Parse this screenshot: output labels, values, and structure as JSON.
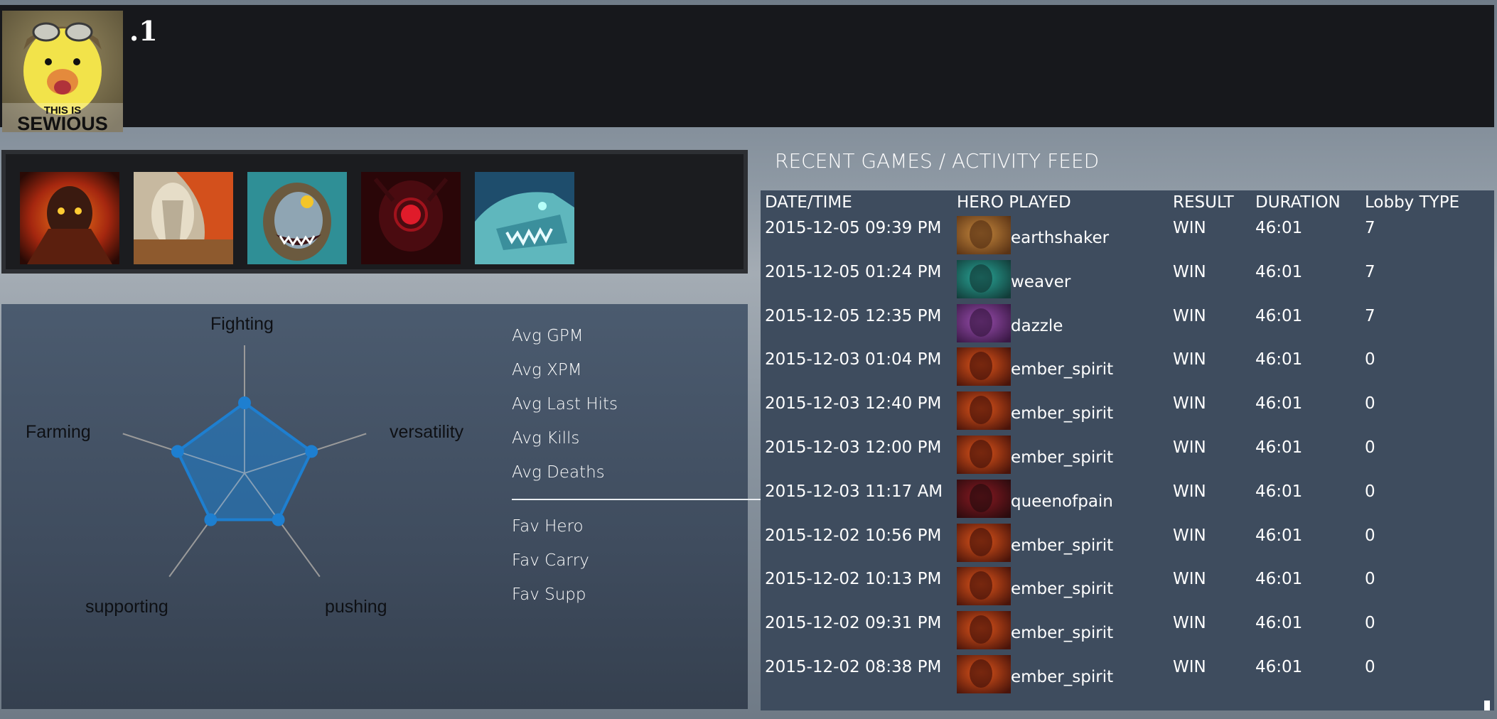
{
  "header": {
    "username": ".1",
    "avatar_caption_top": "THIS IS",
    "avatar_caption_bottom": "SEWIOUS"
  },
  "hero_strip": {
    "heroes": [
      "ember_spirit",
      "juggernaut",
      "slark",
      "shadow_demon",
      "winter_wyvern"
    ]
  },
  "stats": {
    "radar_axes": [
      "Fighting",
      "versatility",
      "pushing",
      "supporting",
      "Farming"
    ],
    "radar_values": [
      0.55,
      0.55,
      0.45,
      0.45,
      0.55
    ],
    "averages": [
      "Avg GPM",
      "Avg XPM",
      "Avg Last Hits",
      "Avg Kills",
      "Avg Deaths"
    ],
    "favorites": [
      "Fav Hero",
      "Fav Carry",
      "Fav Supp"
    ],
    "accent_color": "#1e7fd0"
  },
  "feed": {
    "title": "RECENT GAMES / ACTIVITY FEED",
    "headers": {
      "date": "DATE/TIME",
      "hero": "HERO PLAYED",
      "result": "RESULT",
      "duration": "DURATION",
      "lobby": "Lobby TYPE"
    },
    "rows": [
      {
        "date": "2015-12-05 09:39 PM",
        "hero": "earthshaker",
        "result": "WIN",
        "duration": "46:01",
        "lobby": "7"
      },
      {
        "date": "2015-12-05 01:24 PM",
        "hero": "weaver",
        "result": "WIN",
        "duration": "46:01",
        "lobby": "7"
      },
      {
        "date": "2015-12-05 12:35 PM",
        "hero": "dazzle",
        "result": "WIN",
        "duration": "46:01",
        "lobby": "7"
      },
      {
        "date": "2015-12-03 01:04 PM",
        "hero": "ember_spirit",
        "result": "WIN",
        "duration": "46:01",
        "lobby": "0"
      },
      {
        "date": "2015-12-03 12:40 PM",
        "hero": "ember_spirit",
        "result": "WIN",
        "duration": "46:01",
        "lobby": "0"
      },
      {
        "date": "2015-12-03 12:00 PM",
        "hero": "ember_spirit",
        "result": "WIN",
        "duration": "46:01",
        "lobby": "0"
      },
      {
        "date": "2015-12-03 11:17 AM",
        "hero": "queenofpain",
        "result": "WIN",
        "duration": "46:01",
        "lobby": "0"
      },
      {
        "date": "2015-12-02 10:56 PM",
        "hero": "ember_spirit",
        "result": "WIN",
        "duration": "46:01",
        "lobby": "0"
      },
      {
        "date": "2015-12-02 10:13 PM",
        "hero": "ember_spirit",
        "result": "WIN",
        "duration": "46:01",
        "lobby": "0"
      },
      {
        "date": "2015-12-02 09:31 PM",
        "hero": "ember_spirit",
        "result": "WIN",
        "duration": "46:01",
        "lobby": "0"
      },
      {
        "date": "2015-12-02 08:38 PM",
        "hero": "ember_spirit",
        "result": "WIN",
        "duration": "46:01",
        "lobby": "0"
      }
    ]
  }
}
